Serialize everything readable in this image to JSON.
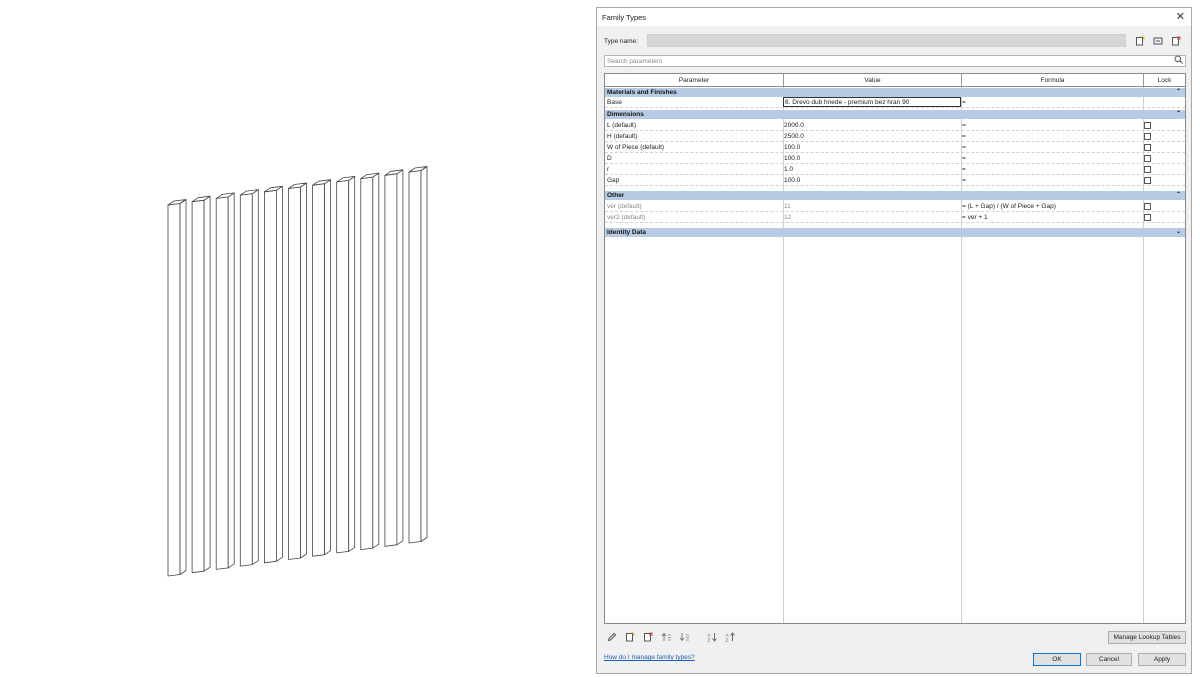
{
  "dialog": {
    "title": "Family Types",
    "close_glyph": "✕",
    "type_name_label": "Type name:",
    "search_placeholder": "Search parameters",
    "columns": {
      "parameter": "Parameter",
      "value": "Value",
      "formula": "Formula",
      "lock": "Lock"
    },
    "groups": {
      "materials": {
        "label": "Materials and Finishes",
        "chevron": "⌃"
      },
      "dimensions": {
        "label": "Dimensions",
        "chevron": "⌃"
      },
      "other": {
        "label": "Other",
        "chevron": "⌃"
      },
      "identity": {
        "label": "Identity Data",
        "chevron": "⌄"
      }
    },
    "rows": {
      "base": {
        "param": "Base",
        "value": "6. Drevo dub hnede - premium bez hran 90",
        "formula": "="
      },
      "l": {
        "param": "L (default)",
        "value": "2000.0",
        "formula": "="
      },
      "h": {
        "param": "H (default)",
        "value": "2500.0",
        "formula": "="
      },
      "w": {
        "param": "W of Piece (default)",
        "value": "100.0",
        "formula": "="
      },
      "d": {
        "param": "D",
        "value": "100.0",
        "formula": "="
      },
      "r": {
        "param": "r",
        "value": "1.0",
        "formula": "="
      },
      "gap": {
        "param": "Gap",
        "value": "100.0",
        "formula": "="
      },
      "ver": {
        "param": "ver (default)",
        "value": "11",
        "formula": "= (L + Gap) / (W of Piece + Gap)"
      },
      "ver2": {
        "param": "ver2 (default)",
        "value": "12",
        "formula": "= ver + 1"
      }
    },
    "buttons": {
      "manage_lookup": "Manage Lookup Tables",
      "ok": "OK",
      "cancel": "Cancel",
      "apply": "Apply"
    },
    "help_link": "How do I manage family types?",
    "icons": {
      "new_type": "new-type-icon",
      "rename_type": "rename-type-icon",
      "delete_type": "delete-type-icon",
      "edit_parameter": "pencil-icon",
      "new_parameter": "new-parameter-icon",
      "delete_parameter": "delete-parameter-icon",
      "move_up": "move-up-icon",
      "move_down": "move-down-icon",
      "sort_asc": "sort-ascending-icon",
      "sort_desc": "sort-descending-icon"
    },
    "accent_color": "#0078d7",
    "group_header_color": "#b7cce4"
  },
  "viewport": {
    "content": "isometric-slats",
    "slat_count": 11
  }
}
